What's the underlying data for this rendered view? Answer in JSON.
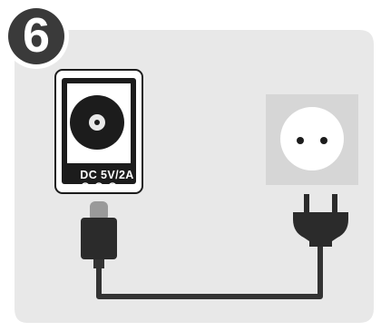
{
  "step": {
    "number": "6"
  },
  "dc_jack": {
    "label": "DC 5V/2A"
  },
  "icons": [
    "dc-jack-icon",
    "polarity-symbol-icon",
    "dc-plug-icon",
    "wall-socket-icon",
    "ac-plug-icon"
  ],
  "colors": {
    "panel": "#e8e8e8",
    "badge": "#3a3a3a",
    "jack_body": "#1c1c1c",
    "socket_plate": "#d6d6d6",
    "socket_face": "#ffffff",
    "cable": "#333333",
    "plug_grip": "#2b2b2b",
    "plug_tip": "#9a9a9a"
  }
}
